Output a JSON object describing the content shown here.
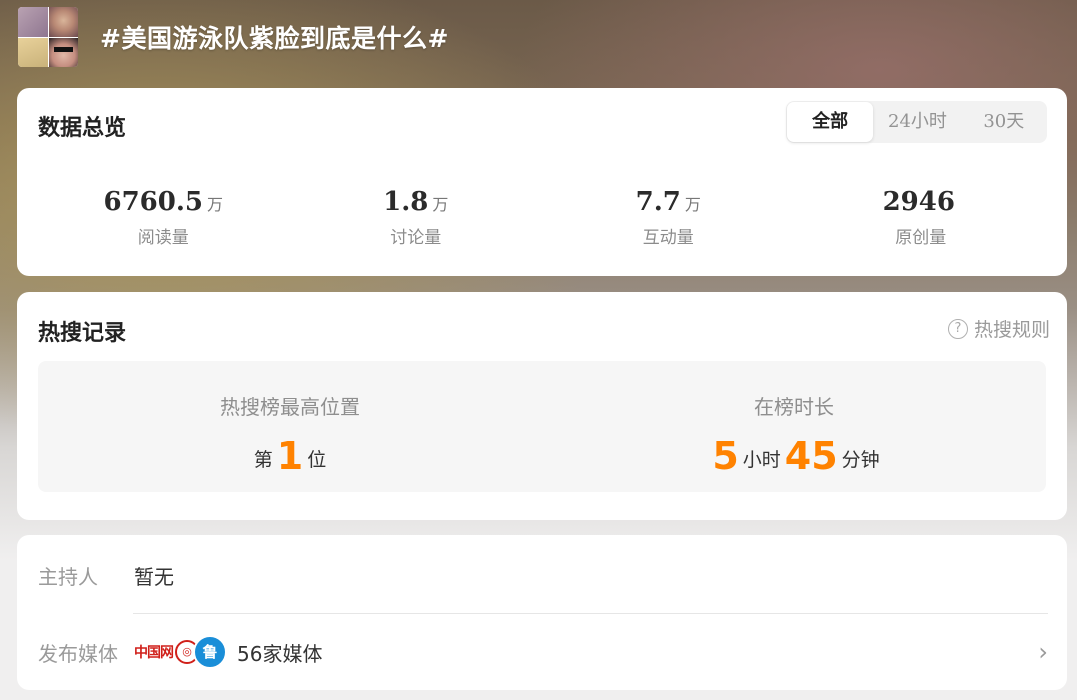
{
  "header": {
    "title": "#美国游泳队紫脸到底是什么#"
  },
  "overview": {
    "title": "数据总览",
    "tabs": [
      {
        "label": "全部",
        "active": true
      },
      {
        "label": "24小时",
        "active": false
      },
      {
        "label": "30天",
        "active": false
      }
    ],
    "stats": [
      {
        "value": "6760.5",
        "unit": "万",
        "label": "阅读量"
      },
      {
        "value": "1.8",
        "unit": "万",
        "label": "讨论量"
      },
      {
        "value": "7.7",
        "unit": "万",
        "label": "互动量"
      },
      {
        "value": "2946",
        "unit": "",
        "label": "原创量"
      }
    ]
  },
  "hot": {
    "title": "热搜记录",
    "rules_label": "热搜规则",
    "rules_icon": "question-circle-icon",
    "highest": {
      "label": "热搜榜最高位置",
      "prefix": "第",
      "value": "1",
      "suffix": "位"
    },
    "duration": {
      "label": "在榜时长",
      "hours": "5",
      "hours_unit": "小时",
      "minutes": "45",
      "minutes_unit": "分钟"
    }
  },
  "info": {
    "host_label": "主持人",
    "host_value": "暂无",
    "media_label": "发布媒体",
    "media_value": "56家媒体",
    "media_logos": [
      "中国网",
      "CNR",
      "鲁"
    ],
    "chevron_icon": "chevron-right-icon"
  },
  "colors": {
    "accent": "#ff8200",
    "text": "#333333",
    "muted": "#9a9a9a"
  }
}
